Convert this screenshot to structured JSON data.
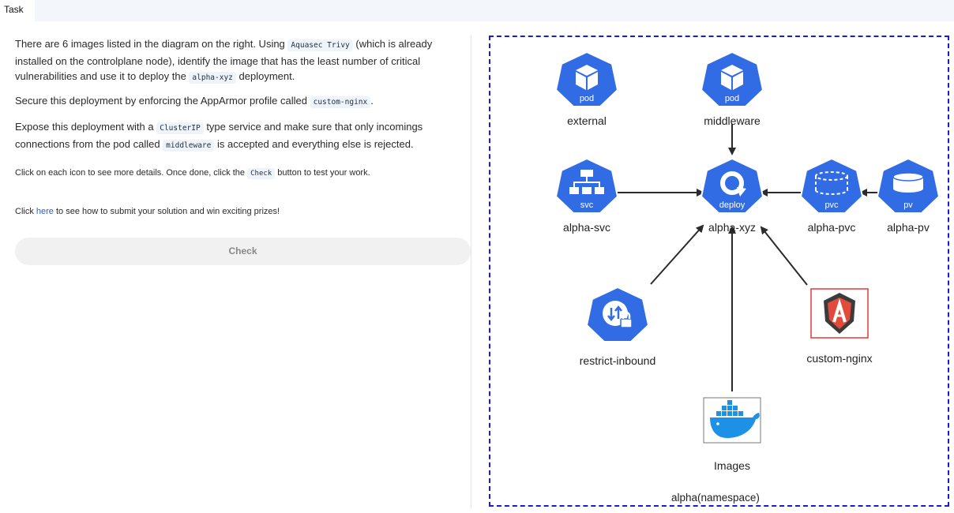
{
  "tab": {
    "label": "Task"
  },
  "task": {
    "p1": {
      "t1": "There are 6 images listed in the diagram on the right. Using ",
      "c1": "Aquasec Trivy",
      "t2": " (which is already installed on the controlplane node), identify the image that has the least number of critical vulnerabilities and use it to deploy the ",
      "c2": "alpha-xyz",
      "t3": " deployment."
    },
    "p2": {
      "t1": "Secure this deployment by enforcing the AppArmor profile called ",
      "c1": "custom-nginx",
      "t2": "."
    },
    "p3": {
      "t1": "Expose this deployment with a ",
      "c1": "ClusterIP",
      "t2": " type service and make sure that only incomings connections from the pod called ",
      "c2": "middleware",
      "t3": " is accepted and everything else is rejected."
    },
    "p4": {
      "t1": "Click on each icon to see more details. Once done, click the ",
      "c1": "Check",
      "t2": " button to test your work."
    },
    "p5": {
      "t1": "Click ",
      "link": "here",
      "t2": " to see how to submit your solution and win exciting prizes!"
    },
    "check_label": "Check"
  },
  "diagram": {
    "namespace_label": "alpha(namespace)",
    "nodes": {
      "external": {
        "badge": "pod",
        "label": "external"
      },
      "middleware": {
        "badge": "pod",
        "label": "middleware"
      },
      "alpha_svc": {
        "badge": "svc",
        "label": "alpha-svc"
      },
      "alpha_xyz": {
        "badge": "deploy",
        "label": "alpha-xyz"
      },
      "alpha_pvc": {
        "badge": "pvc",
        "label": "alpha-pvc"
      },
      "alpha_pv": {
        "badge": "pv",
        "label": "alpha-pv"
      },
      "restrict_inbound": {
        "label": "restrict-inbound"
      },
      "custom_nginx": {
        "label": "custom-nginx"
      },
      "images": {
        "label": "Images"
      }
    },
    "colors": {
      "k8s_blue": "#326ce5",
      "border": "#1a1adc",
      "apparmor_red": "#e03a3a",
      "docker_blue": "#1d91e6"
    }
  }
}
